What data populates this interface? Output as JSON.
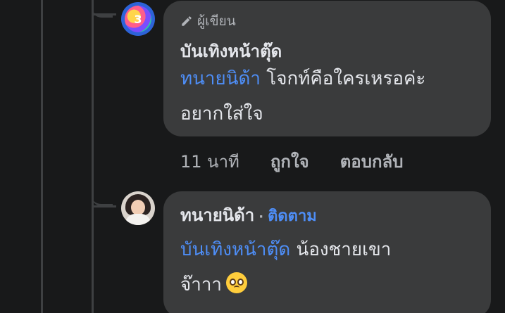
{
  "comments": [
    {
      "author_badge": "ผู้เขียน",
      "author_name": "บันเทิงหน้าตุ๊ด",
      "mention": "ทนายนิด้า",
      "text_line1": " โจกท์คือใครเหรอค่ะ",
      "text_line2": "อยากใส่ใจ",
      "time": "11 นาที",
      "like_label": "ถูกใจ",
      "reply_label": "ตอบกลับ",
      "avatar_text": "3"
    },
    {
      "author_name": "ทนายนิด้า",
      "dot": "·",
      "follow_label": "ติดตาม",
      "mention": "บันเทิงหน้าตุ๊ด",
      "text_line1": " น้องชายเขา",
      "text_line2": "จ๊าาา"
    }
  ],
  "icons": {
    "pencil": "pencil-icon",
    "emoji": "pleading-face-emoji"
  },
  "colors": {
    "background": "#18191a",
    "bubble": "#3a3b3c",
    "mention": "#4e8ef7",
    "text": "#e4e6eb",
    "muted": "#b0b3b8"
  }
}
